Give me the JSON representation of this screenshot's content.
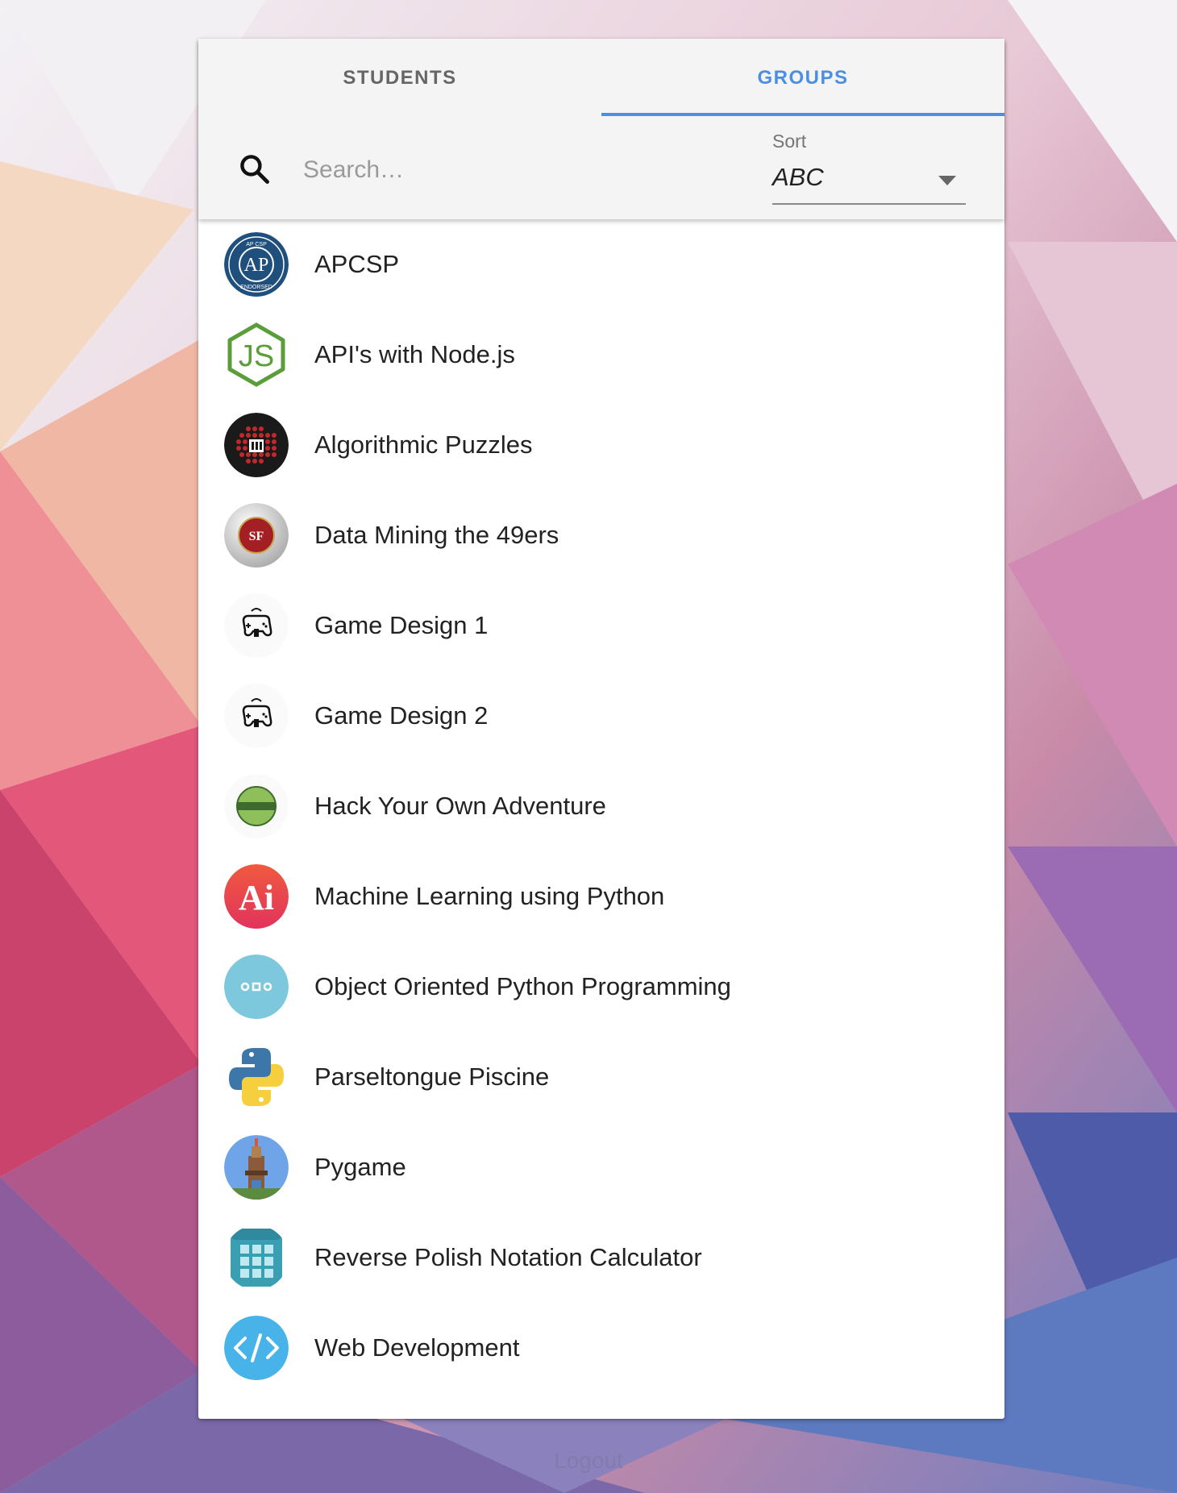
{
  "tabs": [
    {
      "label": "STUDENTS",
      "active": false
    },
    {
      "label": "GROUPS",
      "active": true
    }
  ],
  "search": {
    "placeholder": "Search…",
    "value": "",
    "icon": "search-icon"
  },
  "sort": {
    "label": "Sort",
    "value": "ABC"
  },
  "groups": [
    {
      "name": "APCSP",
      "icon": "ap-csp-endorsed-icon"
    },
    {
      "name": "API's with Node.js",
      "icon": "nodejs-icon"
    },
    {
      "name": "Algorithmic Puzzles",
      "icon": "puzzle-icon"
    },
    {
      "name": "Data Mining the 49ers",
      "icon": "49ers-icon"
    },
    {
      "name": "Game Design 1",
      "icon": "game-controller-icon"
    },
    {
      "name": "Game Design 2",
      "icon": "game-controller-icon"
    },
    {
      "name": "Hack Your Own Adventure",
      "icon": "adventure-icon"
    },
    {
      "name": "Machine Learning using Python",
      "icon": "ai-icon"
    },
    {
      "name": "Object Oriented Python Programming",
      "icon": "oop-icon"
    },
    {
      "name": "Parseltongue Piscine",
      "icon": "python-icon"
    },
    {
      "name": "Pygame",
      "icon": "pygame-icon"
    },
    {
      "name": "Reverse Polish Notation Calculator",
      "icon": "calculator-icon"
    },
    {
      "name": "Web Development",
      "icon": "code-icon"
    }
  ],
  "footer": {
    "logout_label": "Logout"
  },
  "colors": {
    "accent": "#4a90e2",
    "header_bg": "#f4f4f4",
    "list_bg": "#ffffff"
  }
}
